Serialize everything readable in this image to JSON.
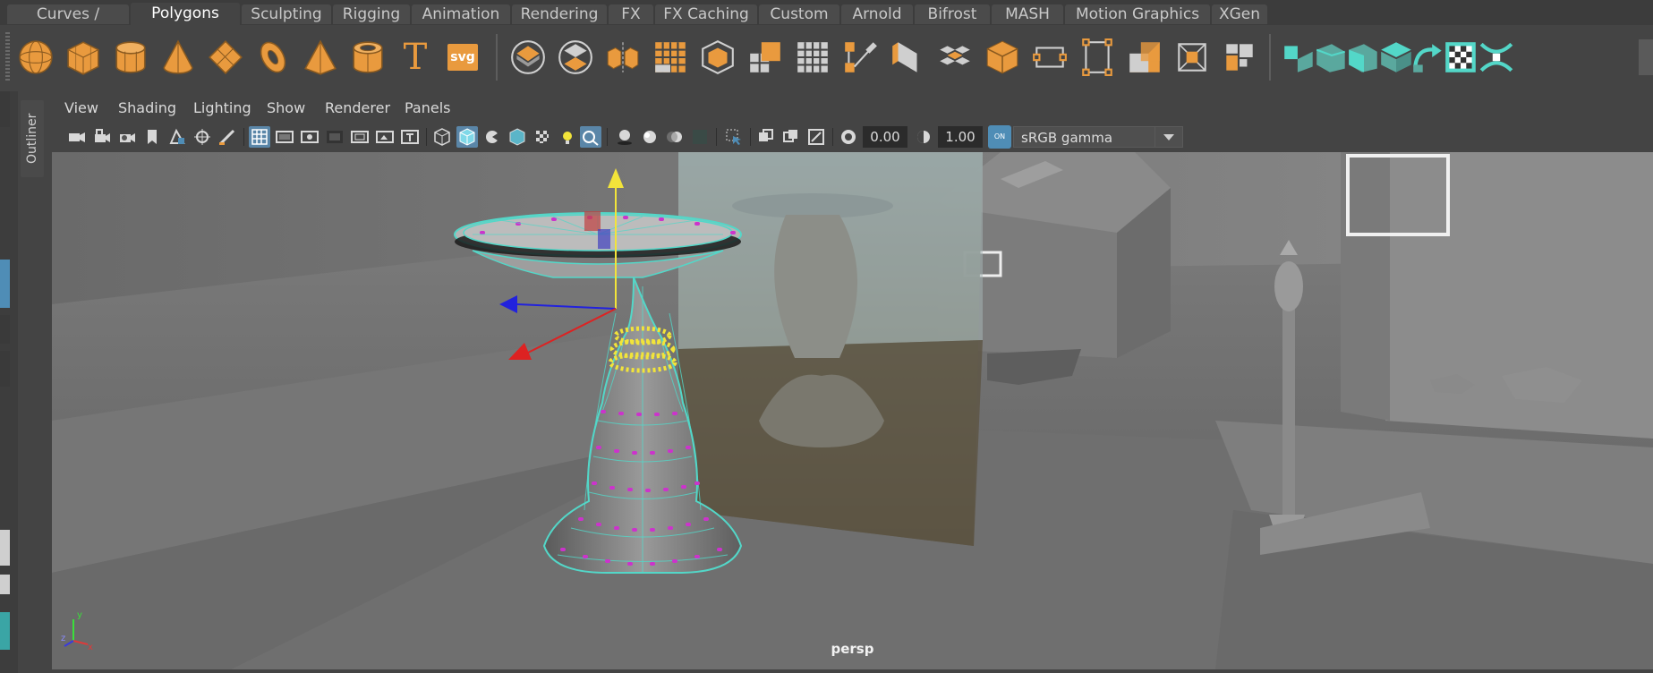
{
  "shelf_tabs": [
    "Curves / Surfaces",
    "Polygons",
    "Sculpting",
    "Rigging",
    "Animation",
    "Rendering",
    "FX",
    "FX Caching",
    "Custom",
    "Arnold",
    "Bifrost",
    "MASH",
    "Motion Graphics",
    "XGen"
  ],
  "active_tab": "Polygons",
  "shelf": {
    "polygon_tools": [
      "poly-sphere-icon",
      "poly-cube-icon",
      "poly-cylinder-icon",
      "poly-cone-icon",
      "poly-plane-icon",
      "poly-torus-icon",
      "poly-pyramid-icon",
      "poly-pipe-icon",
      "poly-type-icon",
      "svg-icon"
    ],
    "type_glyph": "T",
    "svg_label": "svg",
    "edit_tools": [
      "combine-icon",
      "separate-icon",
      "mirror-icon",
      "smooth-icon",
      "average-icon",
      "extrude-icon",
      "bevel-icon",
      "bridge-icon",
      "multi-cut-icon",
      "target-weld-icon",
      "insert-loop-icon",
      "circularize-icon",
      "planar-uv-icon",
      "automatic-uv-icon",
      "uv-editor-icon",
      "uv-layout-icon"
    ],
    "selection_tools": [
      "select-vertex-icon",
      "select-edge-icon",
      "select-face-icon",
      "select-uv-icon",
      "select-toggle-icon",
      "checker-icon",
      "sym-icon"
    ]
  },
  "outliner_label": "Outliner",
  "viewport": {
    "menus": [
      "View",
      "Shading",
      "Lighting",
      "Show",
      "Renderer",
      "Panels"
    ],
    "exposure": "0.00",
    "gamma": "1.00",
    "ocio_badge": "ON",
    "colorspace": "sRGB gamma",
    "camera_label": "persp",
    "axis": {
      "x": "x",
      "y": "y",
      "z": "z"
    }
  },
  "colors": {
    "accent_orange": "#e99a3e",
    "selection_teal": "#53d7c8",
    "highlight_yellow": "#f2e43a",
    "vertex_magenta": "#cc33cc",
    "active_blue": "#5a86a8"
  }
}
